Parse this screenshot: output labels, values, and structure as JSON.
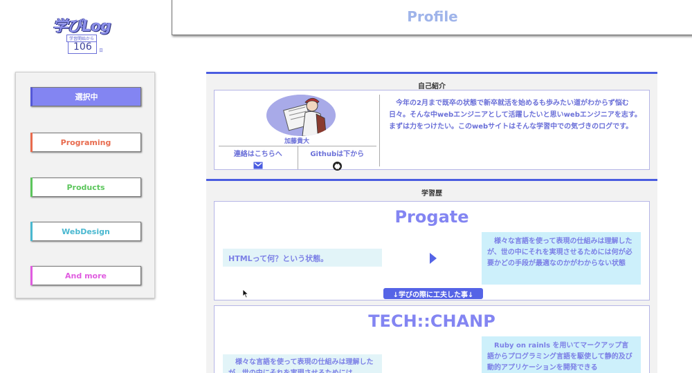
{
  "logo": {
    "title": "学びLog",
    "subtitle": "学習開始から",
    "count": "106",
    "unit": "日"
  },
  "header": {
    "title": "Profile"
  },
  "sidebar": {
    "items": [
      {
        "label": "選択中",
        "color": "#ffffff",
        "edge": "#5558d8",
        "active": true
      },
      {
        "label": "Programing",
        "color": "#e86b4e",
        "edge": "#e86b4e"
      },
      {
        "label": "Products",
        "color": "#5cc65c",
        "edge": "#5cc65c"
      },
      {
        "label": "WebDesign",
        "color": "#4ab8d0",
        "edge": "#4ab8d0"
      },
      {
        "label": "And more",
        "color": "#e05ce0",
        "edge": "#e05ce0"
      }
    ]
  },
  "intro": {
    "section_title": "自己紹介",
    "name": "加藤貴大",
    "contact_label": "連絡はこちらへ",
    "contact_icon": "mail-icon",
    "github_label": "Githubは下から",
    "github_icon": "github-icon",
    "text": "今年の2月まで既卒の状態で新卒就活を始めるも歩みたい道がわからず悩む日々。そんな中webエンジニアとして活躍したいと思いwebエンジニアを志す。まずは力をつけたい。このwebサイトはそんな学習中での気づきのログです。"
  },
  "history": {
    "section_title": "学習歴",
    "courses": [
      {
        "title": "Progate",
        "before": "HTMLって何？という状態。",
        "after": "様々な言語を使って表現の仕組みは理解したが、世の中にそれを実現させるためには何が必要かどの手段が最適なのかがわからない状態",
        "tip_button": "↓学びの際に工夫した事↓"
      },
      {
        "title": "TECH::CHANP",
        "before": "様々な言語を使って表現の仕組みは理解したが、世の中にそれを実現させるためには",
        "after": "Ruby on rainls を用いてマークアップ言語からプログラミング言語を駆使して静的及び動的アプリケーションを開発できる"
      }
    ]
  },
  "colors": {
    "accent": "#8385f2",
    "section_bar": "#4a5ce0",
    "text": "#6a6fd8"
  }
}
